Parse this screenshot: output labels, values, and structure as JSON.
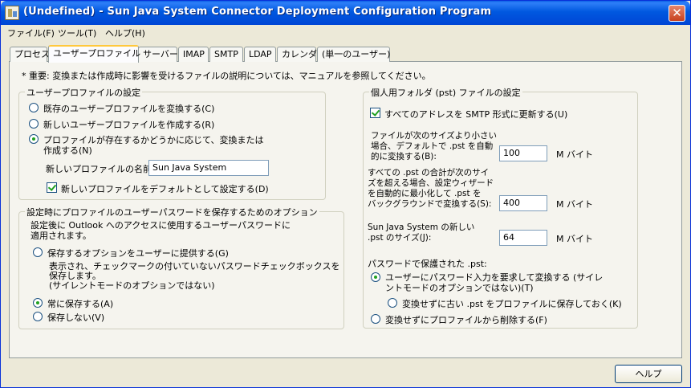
{
  "window": {
    "title": "(Undefined) - Sun Java System Connector Deployment Configuration Program",
    "close_glyph": "✕"
  },
  "menu": {
    "file": "ファイル(F)",
    "tool": "ツール(T)",
    "help": "ヘルプ(H)"
  },
  "tabs": [
    "プロセス",
    "ユーザープロファイル",
    "サーバー",
    "IMAP",
    "SMTP",
    "LDAP",
    "カレンダ",
    "(単一のユーザー)"
  ],
  "note": "* 重要: 変換または作成時に影響を受けるファイルの説明については、マニュアルを参照してください。",
  "profile_settings": {
    "title": "ユーザープロファイルの設定",
    "opt_convert": "既存のユーザープロファイルを変換する(C)",
    "opt_create": "新しいユーザープロファイルを作成する(R)",
    "opt_auto_line1": "プロファイルが存在するかどうかに応じて、変換または",
    "opt_auto_line2": "作成する(N)",
    "new_name_label": "新しいプロファイルの名前",
    "new_name_value": "Sun Java System",
    "default_label": "新しいプロファイルをデフォルトとして設定する(D)"
  },
  "password_options": {
    "title": "設定時にプロファイルのユーザーパスワードを保存するためのオプション",
    "desc_line1": "設定後に Outlook へのアクセスに使用するユーザーパスワードに",
    "desc_line2": "適用されます。",
    "opt_offer": "保存するオプションをユーザーに提供する(G)",
    "offer_desc_line1": "表示され、チェックマークの付いていないパスワードチェックボックスを",
    "offer_desc_line2": "保存します。",
    "offer_desc_line3": "(サイレントモードのオプションではない)",
    "opt_always": "常に保存する(A)",
    "opt_never": "保存しない(V)"
  },
  "pst_settings": {
    "title": "個人用フォルダ (pst) ファイルの設定",
    "smtp_label": "すべてのアドレスを SMTP 形式に更新する(U)",
    "size_label_line1": "ファイルが次のサイズより小さい",
    "size_label_line2": "場合、デフォルトで .pst を自動",
    "size_label_line3": "的に変換する(B):",
    "size_value": "100",
    "size_unit": "M バイト",
    "total_label_line1": "すべての .pst の合計が次のサイ",
    "total_label_line2": "ズを超える場合、設定ウィザード",
    "total_label_line3": "を自動的に最小化して .pst を",
    "total_label_line4": "バックグラウンドで変換する(S):",
    "total_value": "400",
    "total_unit": "M バイト",
    "new_size_label_line1": "Sun Java System の新しい",
    "new_size_label_line2": ".pst のサイズ(J):",
    "new_size_value": "64",
    "new_size_unit": "M バイト",
    "protected_label": "パスワードで保護された .pst:",
    "opt_prompt_line1": "ユーザーにパスワード入力を要求して変換する (サイレ",
    "opt_prompt_line2": "ントモードのオプションではない)(T)",
    "opt_keep_old": "変換せずに古い .pst をプロファイルに保存しておく(K)",
    "opt_remove": "変換せずにプロファイルから削除する(F)"
  },
  "buttons": {
    "help": "ヘルプ"
  },
  "colors": {
    "titlebar": "#0054e3",
    "check_mark": "#21a121",
    "tab_highlight": "#ffc83c"
  }
}
